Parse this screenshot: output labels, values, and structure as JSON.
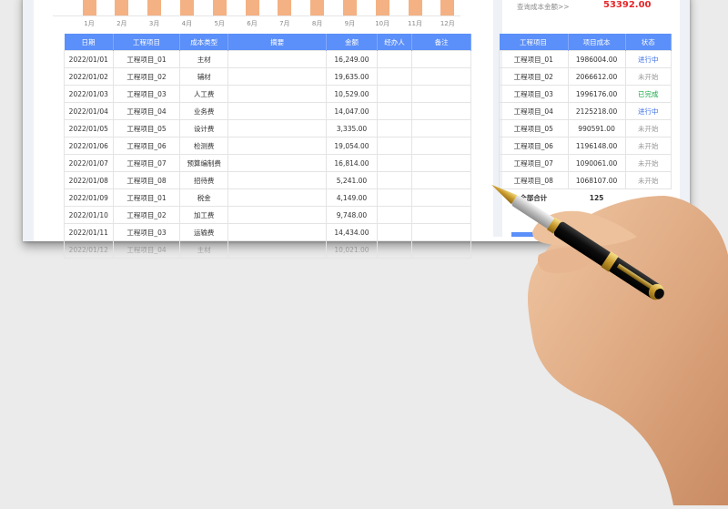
{
  "chart": {
    "type": "bar",
    "months": [
      "1月",
      "2月",
      "3月",
      "4月",
      "5月",
      "6月",
      "7月",
      "8月",
      "9月",
      "10月",
      "11月",
      "12月"
    ],
    "bar_color": "#f4b183"
  },
  "main_table": {
    "headers": [
      "日期",
      "工程项目",
      "成本类型",
      "摘要",
      "金额",
      "经办人",
      "备注"
    ],
    "rows": [
      [
        "2022/01/01",
        "工程项目_01",
        "主材",
        "",
        "16,249.00",
        "",
        ""
      ],
      [
        "2022/01/02",
        "工程项目_02",
        "辅材",
        "",
        "19,635.00",
        "",
        ""
      ],
      [
        "2022/01/03",
        "工程项目_03",
        "人工费",
        "",
        "10,529.00",
        "",
        ""
      ],
      [
        "2022/01/04",
        "工程项目_04",
        "业务费",
        "",
        "14,047.00",
        "",
        ""
      ],
      [
        "2022/01/05",
        "工程项目_05",
        "设计费",
        "",
        "3,335.00",
        "",
        ""
      ],
      [
        "2022/01/06",
        "工程项目_06",
        "检测费",
        "",
        "19,054.00",
        "",
        ""
      ],
      [
        "2022/01/07",
        "工程项目_07",
        "预算编制费",
        "",
        "16,814.00",
        "",
        ""
      ],
      [
        "2022/01/08",
        "工程项目_08",
        "招待费",
        "",
        "5,241.00",
        "",
        ""
      ],
      [
        "2022/01/09",
        "工程项目_01",
        "税金",
        "",
        "4,149.00",
        "",
        ""
      ],
      [
        "2022/01/10",
        "工程项目_02",
        "加工费",
        "",
        "9,748.00",
        "",
        ""
      ],
      [
        "2022/01/11",
        "工程项目_03",
        "运输费",
        "",
        "14,434.00",
        "",
        ""
      ],
      [
        "2022/01/12",
        "工程项目_04",
        "主材",
        "",
        "10,021.00",
        "",
        ""
      ]
    ]
  },
  "query": {
    "label": "查询成本金额>>",
    "value": "53392.00"
  },
  "side_table": {
    "headers": [
      "工程项目",
      "项目成本",
      "状态"
    ],
    "rows": [
      {
        "project": "工程项目_01",
        "cost": "1986004.00",
        "status": "进行中",
        "status_type": "blue"
      },
      {
        "project": "工程项目_02",
        "cost": "2066612.00",
        "status": "未开始",
        "status_type": "gray"
      },
      {
        "project": "工程项目_03",
        "cost": "1996176.00",
        "status": "已完成",
        "status_type": "green"
      },
      {
        "project": "工程项目_04",
        "cost": "2125218.00",
        "status": "进行中",
        "status_type": "blue"
      },
      {
        "project": "工程项目_05",
        "cost": "990591.00",
        "status": "未开始",
        "status_type": "gray"
      },
      {
        "project": "工程项目_06",
        "cost": "1196148.00",
        "status": "未开始",
        "status_type": "gray"
      },
      {
        "project": "工程项目_07",
        "cost": "1090061.00",
        "status": "未开始",
        "status_type": "gray"
      },
      {
        "project": "工程项目_08",
        "cost": "1068107.00",
        "status": "未开始",
        "status_type": "gray"
      }
    ],
    "total_label": "全部合计",
    "total_value_partial": "125"
  },
  "colors": {
    "header_blue": "#5b8ff9",
    "query_red": "#e6262a",
    "status_blue": "#3b6fe8",
    "status_green": "#17a844",
    "status_gray": "#9a9a9a"
  }
}
